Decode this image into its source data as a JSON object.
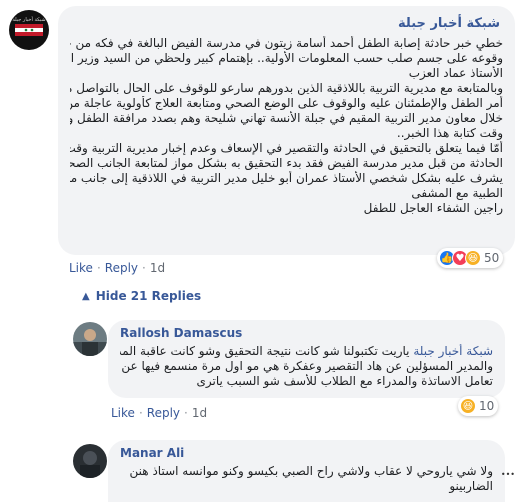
{
  "main_comment": {
    "author": "شبكة أخبار جبلة",
    "avatar_text": "شبكة أخبار جبلة",
    "body_lines": [
      "خطيٍ خبر حادثة إصابة الطفل أحمد أسامة زيتون في مدرسة الفيض البالغة في فكه من جراء",
      "وقوعه على جسم صلب حسب المعلومات الأولية.. بإهتمام كبير ولحظي من السيد وزير التربية",
      "الأستاذ عماد العزب",
      "وبالمتابعة مع مديرية التربية باللاذقية الذين بدورهم سارعو للوقوف على الحال بالتواصل مع أولياء",
      "أمر الطفل والإطمئنان عليه والوقوف على الوضع الصحي ومتابعة العلاج كأولوية عاجلة من",
      "خلال معاون مدير التربية المقيم في جبلة الأنسة تهاني شليحة وهم بصدد مرافقة الطفل وأسرته إلى",
      "وقت كتابة هذا الخبر..",
      "أمّا فيما يتعلق بالتحقيق في الحادثة والتقصير في الإسعاف وعدم إخبار مديرية التربية وقت وقوع",
      "الحادثة من قبل مدير مدرسة الفيض فقد بدء التحقيق به بشكل مواز لمتابعة الجانب الصحي و",
      "يشرف عليه بشكل شخصي الأستاذ عمران أبو خليل مدير التربية في اللاذقية إلى جانب متابعة حالته",
      "الطبية مع المشفى",
      "راجين الشفاء العاجل للطفل"
    ],
    "actions": {
      "like": "Like",
      "reply": "Reply",
      "time": "1d",
      "dot": "·"
    },
    "reactions": {
      "count": "50"
    },
    "hide_replies": "Hide 21 Replies"
  },
  "replies": [
    {
      "author": "Rallosh Damascus",
      "tag": "شبكة أخبار جبلة",
      "body_lines": [
        "ياريت تكتبولنا شو كانت نتيجة التحقيق وشو كانت عاقبة المدرسين",
        "والمدير المسؤلين عن هاد التقصير وعفكرة هي مو اول مرة منسمع فيها عن سوء",
        "تعامل الاساتذة والمدراء مع الطلاب للأسف شو السبب ياترى"
      ],
      "actions": {
        "like": "Like",
        "reply": "Reply",
        "time": "1d",
        "dot": "·"
      },
      "reactions": {
        "count": "10"
      }
    },
    {
      "author": "Manar Ali",
      "body_lines": [
        "ولا شي ياروحي لا عقاب ولاشي راح الصبي بكيسو وكنو موانسه استاذ هنن",
        "الضاربينو"
      ]
    }
  ],
  "colors": {
    "link": "#385898",
    "bubble": "#f2f3f5",
    "like_blue": "#1877f2",
    "love_red": "#f33e58",
    "haha_yellow": "#f7b125"
  }
}
